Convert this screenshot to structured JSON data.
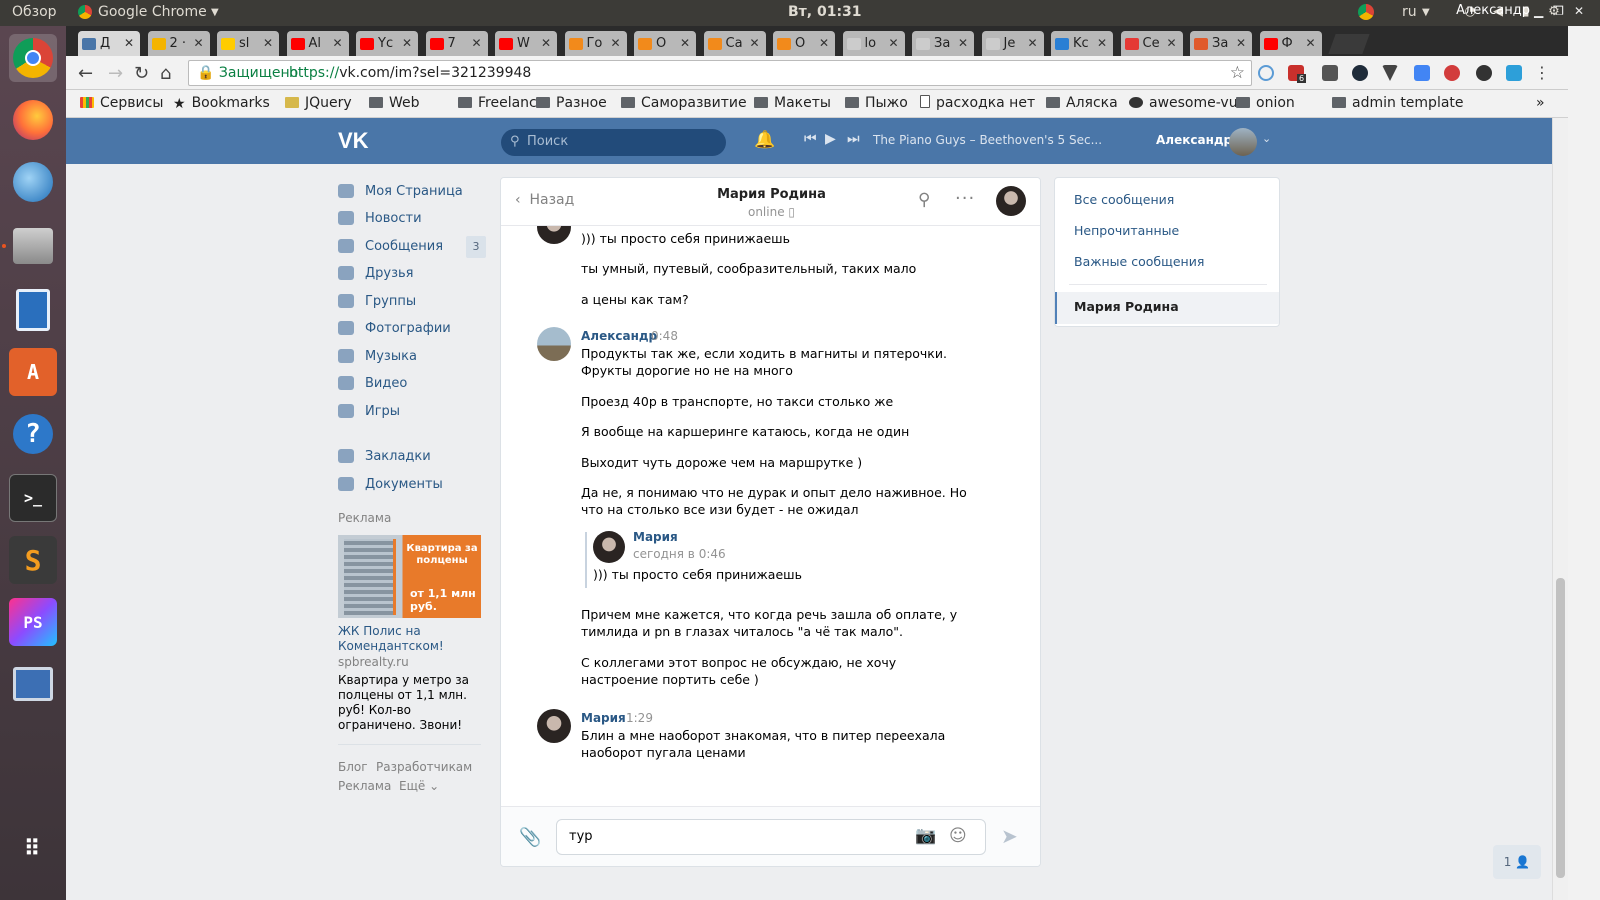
{
  "os": {
    "overview": "Обзор",
    "app_name": "Google Chrome",
    "clock": "Вт, 01:31",
    "lang": "ru"
  },
  "launcher": {
    "terminal_glyph": ">_",
    "sublime_glyph": "S",
    "phpstorm_glyph": "PS",
    "help_glyph": "?",
    "appstore_glyph": "A"
  },
  "browser": {
    "tabs": [
      {
        "label": "Д"
      },
      {
        "label": "2 ·"
      },
      {
        "label": "sl"
      },
      {
        "label": "Al"
      },
      {
        "label": "Yc"
      },
      {
        "label": "7"
      },
      {
        "label": "W"
      },
      {
        "label": "Го"
      },
      {
        "label": "O"
      },
      {
        "label": "Ca"
      },
      {
        "label": "O"
      },
      {
        "label": "lo"
      },
      {
        "label": "За"
      },
      {
        "label": "Je"
      },
      {
        "label": "Kc"
      },
      {
        "label": "Ce"
      },
      {
        "label": "За"
      },
      {
        "label": "Ф"
      }
    ],
    "tab_close": "✕",
    "profile_name": "Александр",
    "secure_label": "Защищено",
    "url_scheme": "https://",
    "url_rest": "vk.com/im?sel=321239948",
    "bookmarks": [
      "Сервисы",
      "Bookmarks",
      "JQuery",
      "Web",
      "Freelance",
      "Разное",
      "Саморазвитие",
      "Макеты",
      "Пыжо",
      "расходка нет",
      "Аляска",
      "awesome-vue",
      "onion",
      "admin template"
    ],
    "bookmarks_more": "»",
    "ext_badge": "6"
  },
  "vk": {
    "search_placeholder": "Поиск",
    "player_track": "The Piano Guys – Beethoven's 5 Sec...",
    "user_name": "Александр",
    "nav": [
      "Моя Страница",
      "Новости",
      "Сообщения",
      "Друзья",
      "Группы",
      "Фотографии",
      "Музыка",
      "Видео",
      "Игры"
    ],
    "nav2": [
      "Закладки",
      "Документы"
    ],
    "messages_count": "3",
    "ad": {
      "label": "Реклама",
      "image_title": "Квартира за полцены",
      "image_price": "от 1,1 млн руб.",
      "title": "ЖК Полис на Комендантском!",
      "site": "spbrealty.ru",
      "text": "Квартира у метро за полцены от 1,1 млн. руб! Кол-во ограничено. Звони!"
    },
    "footer": {
      "blog": "Блог",
      "dev": "Разработчикам",
      "ads": "Реклама",
      "more": "Ещё ⌄"
    },
    "chat": {
      "back": "Назад",
      "name": "Мария Родина",
      "status": "online",
      "messages": [
        {
          "text": "))) ты просто себя принижаешь"
        },
        {
          "text": "ты умный, путевый, сообразительный, таких мало"
        },
        {
          "text": "а цены как там?"
        },
        {
          "author": "Александр",
          "time": "0:48",
          "text": "Продукты так же, если ходить в магниты и пятерочки. Фрукты дорогие но не на много"
        },
        {
          "text": "Проезд 40р в транспорте, но такси столько же"
        },
        {
          "text": "Я вообще на каршеринге катаюсь, когда не один"
        },
        {
          "text": "Выходит чуть дороже чем на маршрутке )"
        },
        {
          "text": "Да не, я понимаю что не дурак и опыт дело наживное. Но что на столько все изи будет - не ожидал"
        },
        {
          "text": "Причем мне кажется, что когда речь зашла об оплате, у тимлида и pn в глазах читалось \"а чё так мало\"."
        },
        {
          "text": "С коллегами этот вопрос не обсуждаю, не хочу настроение портить себе )"
        },
        {
          "author": "Мария",
          "time": "1:29",
          "text": "Блин а мне наоборот знакомая, что в питер переехала наоборот пугала ценами"
        }
      ],
      "forward": {
        "author": "Мария",
        "time": "сегодня в 0:46",
        "text": "))) ты просто себя принижаешь"
      },
      "input_value": "тур"
    },
    "right_menu": {
      "all": "Все сообщения",
      "unread": "Непрочитанные",
      "important": "Важные сообщения",
      "active": "Мария Родина"
    },
    "online_count": "1"
  }
}
